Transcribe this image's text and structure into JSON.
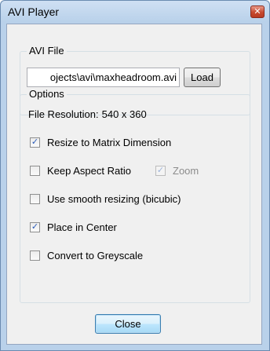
{
  "window": {
    "title": "AVI Player",
    "close_glyph": "✕"
  },
  "file": {
    "group_label": "AVI File",
    "path": "ojects\\avi\\maxheadroom.avi",
    "load_label": "Load"
  },
  "options": {
    "group_label": "Options",
    "resolution_label": "File Resolution:",
    "resolution_value": "540 x 360",
    "resize": {
      "label": "Resize to Matrix Dimension",
      "checked": true
    },
    "keep_aspect": {
      "label": "Keep Aspect Ratio",
      "checked": false
    },
    "zoom": {
      "label": "Zoom",
      "checked": true,
      "enabled": false
    },
    "smooth": {
      "label": "Use smooth resizing (bicubic)",
      "checked": false
    },
    "center": {
      "label": "Place in Center",
      "checked": true
    },
    "greyscale": {
      "label": "Convert to Greyscale",
      "checked": false
    }
  },
  "footer": {
    "close_label": "Close"
  }
}
